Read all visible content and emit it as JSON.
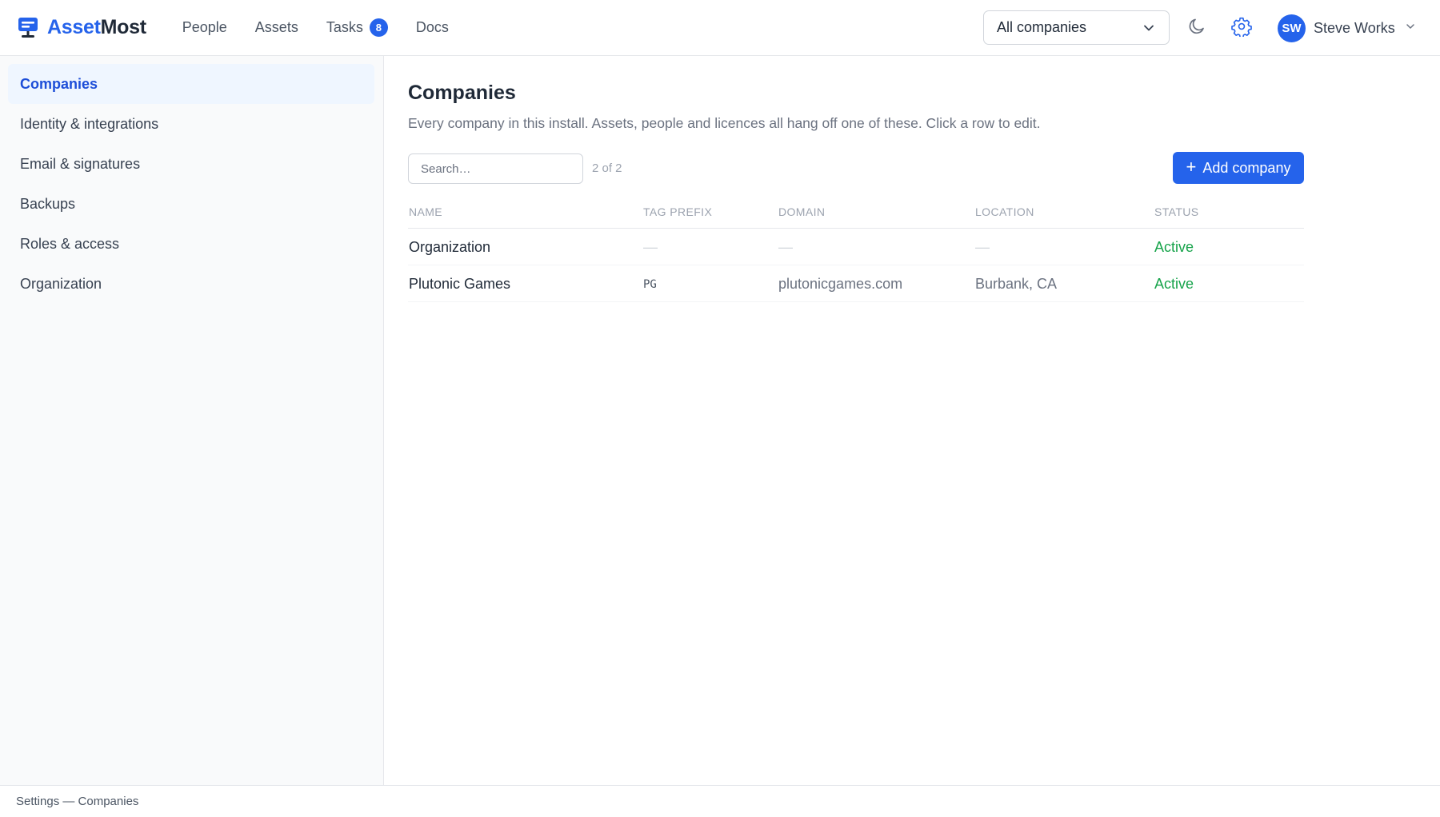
{
  "app": {
    "brand_part1": "Asset",
    "brand_part2": "Most",
    "accent_color": "#2563eb"
  },
  "nav": {
    "people": "People",
    "assets": "Assets",
    "tasks": "Tasks",
    "tasks_badge": "8",
    "docs": "Docs"
  },
  "header": {
    "company_filter": "All companies",
    "user_initials": "SW",
    "user_name": "Steve Works"
  },
  "sidebar": {
    "items": [
      {
        "label": "Companies",
        "active": true
      },
      {
        "label": "Identity & integrations"
      },
      {
        "label": "Email & signatures"
      },
      {
        "label": "Backups"
      },
      {
        "label": "Roles & access"
      },
      {
        "label": "Organization"
      }
    ]
  },
  "main": {
    "title": "Companies",
    "subtitle": "Every company in this install. Assets, people and licences all hang off one of these. Click a row to edit.",
    "search_placeholder": "Search…",
    "count": "2 of 2",
    "add_label": "Add company",
    "columns": [
      "NAME",
      "TAG PREFIX",
      "DOMAIN",
      "LOCATION",
      "STATUS"
    ],
    "rows": [
      {
        "name": "Organization",
        "tag": "—",
        "domain": "—",
        "location": "—",
        "status": "Active"
      },
      {
        "name": "Plutonic Games",
        "tag": "PG",
        "domain": "plutonicgames.com",
        "location": "Burbank, CA",
        "status": "Active"
      }
    ]
  },
  "footer": {
    "breadcrumb": "Settings — Companies"
  }
}
